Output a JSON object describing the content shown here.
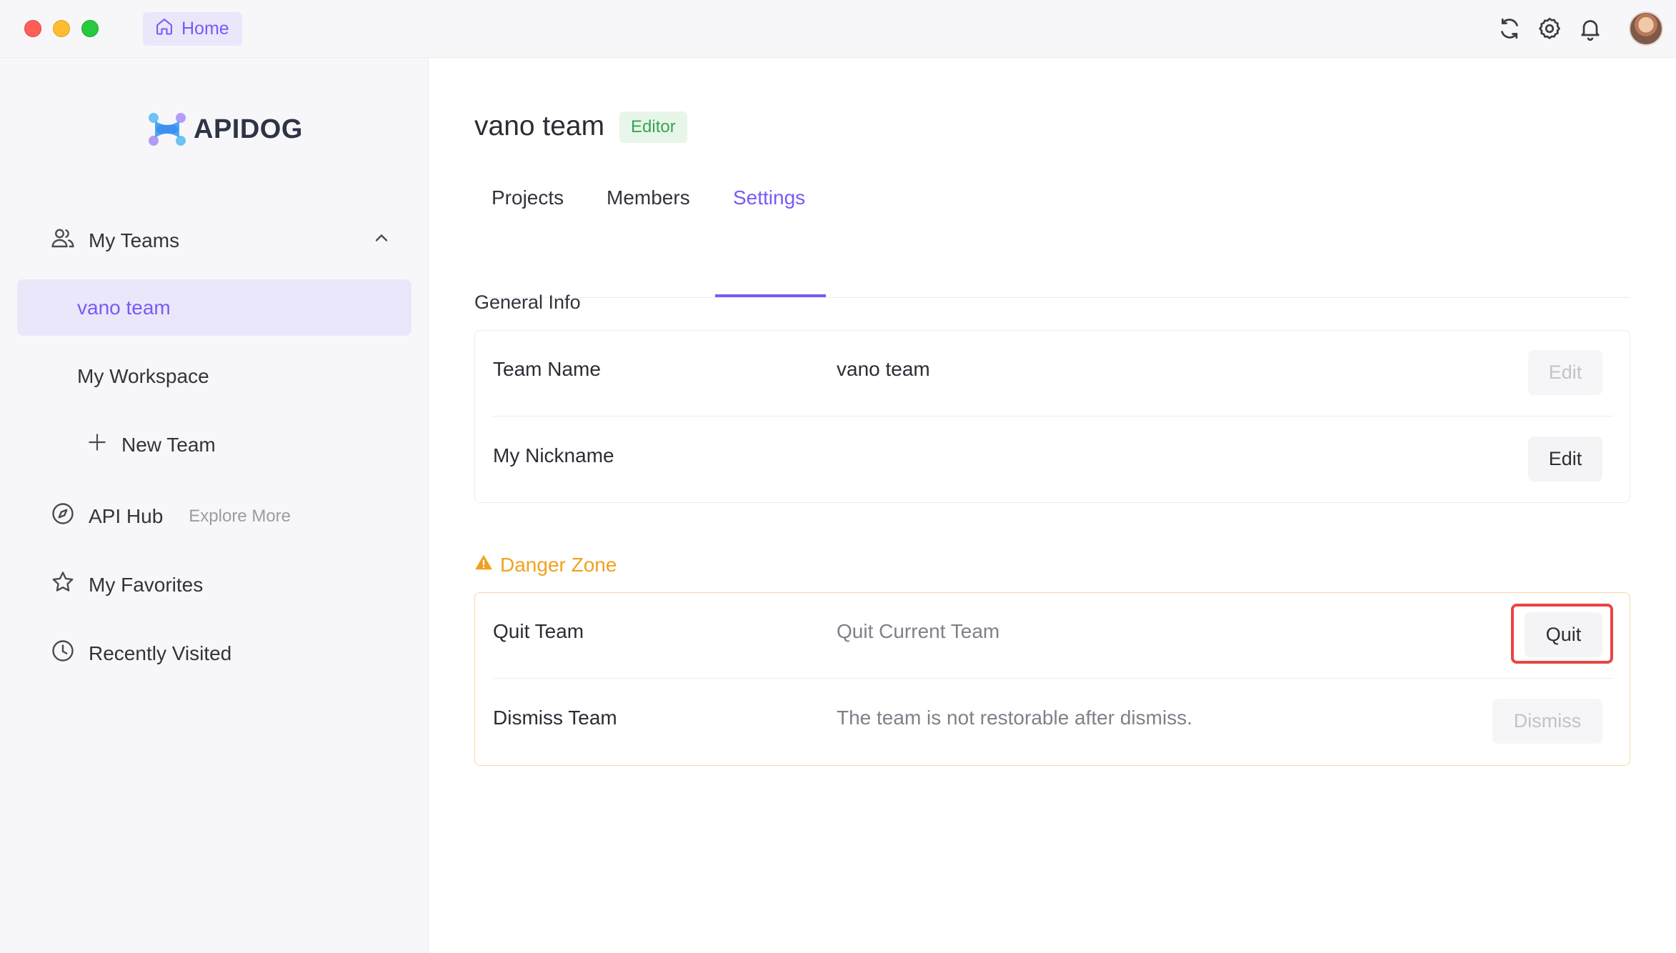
{
  "titlebar": {
    "home_tab_label": "Home",
    "icons": [
      "sync-icon",
      "gear-icon",
      "bell-icon"
    ]
  },
  "sidebar": {
    "logo_text": "APIDOG",
    "my_teams_label": "My Teams",
    "teams": [
      {
        "label": "vano team",
        "active": true
      }
    ],
    "workspace_label": "My Workspace",
    "new_team_label": "New Team",
    "api_hub_label": "API Hub",
    "explore_label": "Explore More",
    "favorites_label": "My Favorites",
    "recent_label": "Recently Visited"
  },
  "main": {
    "team_title": "vano team",
    "role_badge": "Editor",
    "tabs": [
      {
        "label": "Projects",
        "active": false
      },
      {
        "label": "Members",
        "active": false
      },
      {
        "label": "Settings",
        "active": true
      }
    ],
    "general_info": {
      "title": "General Info",
      "rows": [
        {
          "label": "Team Name",
          "value": "vano team",
          "button": "Edit",
          "button_disabled": true
        },
        {
          "label": "My Nickname",
          "value": "",
          "button": "Edit",
          "button_disabled": false
        }
      ]
    },
    "danger_zone": {
      "title": "Danger Zone",
      "rows": [
        {
          "label": "Quit Team",
          "desc": "Quit Current Team",
          "button": "Quit",
          "button_disabled": false
        },
        {
          "label": "Dismiss Team",
          "desc": "The team is not restorable after dismiss.",
          "button": "Dismiss",
          "button_disabled": true
        }
      ]
    }
  },
  "colors": {
    "accent": "#7a5af5",
    "editor_badge_bg": "#e8f6ea",
    "editor_badge_text": "#3aa352",
    "danger": "#f0a21f",
    "highlight": "#e84545"
  }
}
